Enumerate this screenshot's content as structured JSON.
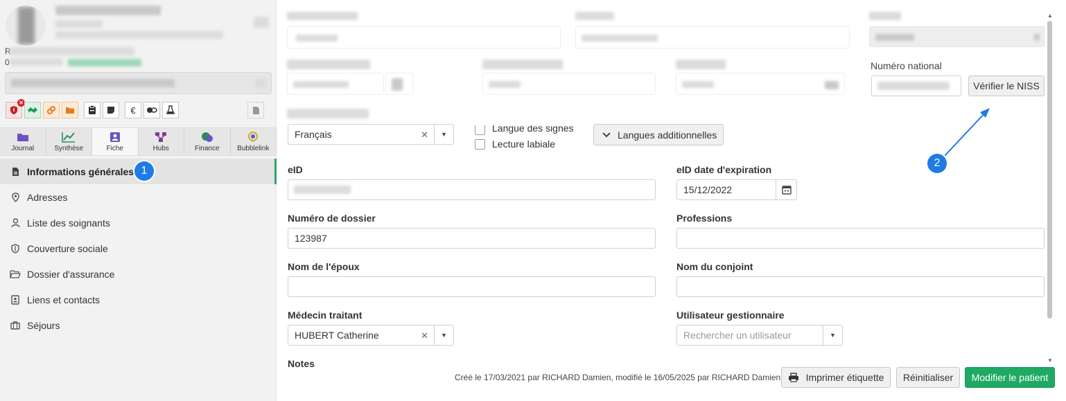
{
  "sidebar": {
    "stray_chars": [
      "R",
      "0"
    ],
    "tabs": [
      {
        "label": "Journal",
        "icon": "folder-icon"
      },
      {
        "label": "Synthèse",
        "icon": "chart-line-icon"
      },
      {
        "label": "Fiche",
        "icon": "id-card-icon"
      },
      {
        "label": "Hubs",
        "icon": "network-icon"
      },
      {
        "label": "Finance",
        "icon": "finance-icon"
      },
      {
        "label": "Bubblelink",
        "icon": "bubblelink-icon"
      }
    ],
    "menu": [
      {
        "label": "Informations générales",
        "icon": "document-icon",
        "active": true
      },
      {
        "label": "Adresses",
        "icon": "map-pin-icon"
      },
      {
        "label": "Liste des soignants",
        "icon": "user-doctor-icon"
      },
      {
        "label": "Couverture sociale",
        "icon": "shield-icon"
      },
      {
        "label": "Dossier d'assurance",
        "icon": "folder-open-icon"
      },
      {
        "label": "Liens et contacts",
        "icon": "contact-book-icon"
      },
      {
        "label": "Séjours",
        "icon": "suitcase-icon"
      }
    ],
    "quick_icons": [
      "shield-alert-icon",
      "handshake-icon",
      "link-icon",
      "folder-icon",
      "clipboard-icon",
      "note-icon",
      "euro-icon",
      "pills-icon",
      "flask-icon",
      "pdf-icon"
    ],
    "euro_symbol": "€"
  },
  "steps": {
    "one": "1",
    "two": "2"
  },
  "form": {
    "numero_national_label": "Numéro national",
    "verifier_niss": "Vérifier le NISS",
    "langue": {
      "value": "Français",
      "clear": "✕"
    },
    "langue_signes": "Langue des signes",
    "lecture_labiale": "Lecture labiale",
    "langues_additionnelles": "Langues additionnelles",
    "eid_label": "eID",
    "eid_expiration_label": "eID date d'expiration",
    "eid_expiration_value": "15/12/2022",
    "numero_dossier_label": "Numéro de dossier",
    "numero_dossier_value": "123987",
    "professions_label": "Professions",
    "professions_value": "",
    "nom_epoux_label": "Nom de l'époux",
    "nom_epoux_value": "",
    "nom_conjoint_label": "Nom du conjoint",
    "nom_conjoint_value": "",
    "medecin_traitant_label": "Médecin traitant",
    "medecin_traitant_value": "HUBERT Catherine",
    "utilisateur_label": "Utilisateur gestionnaire",
    "utilisateur_placeholder": "Rechercher un utilisateur",
    "notes_label": "Notes"
  },
  "footer": {
    "meta": "Créé le 17/03/2021 par RICHARD Damien, modifié le 16/05/2025 par RICHARD Damien",
    "print_label": "Imprimer étiquette",
    "reset_label": "Réinitialiser",
    "save_label": "Modifier le patient"
  },
  "colors": {
    "accent_green": "#1faa64",
    "step_blue": "#1f7be6",
    "alert_red": "#d9212c"
  }
}
